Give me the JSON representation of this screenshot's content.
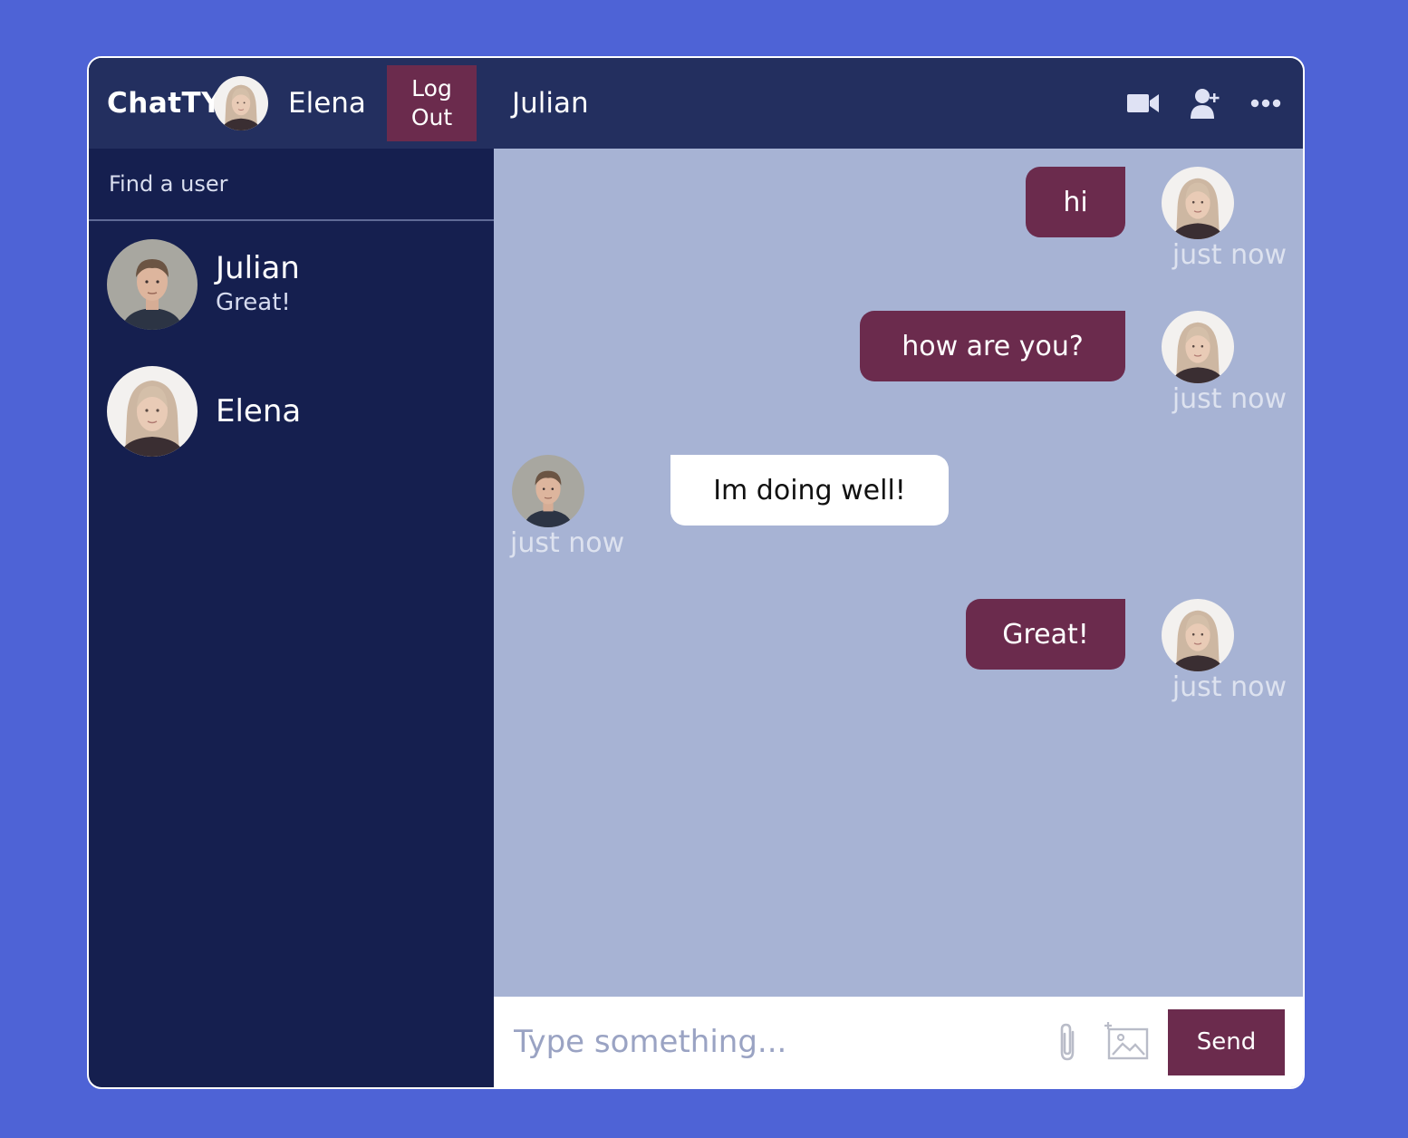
{
  "app": {
    "logo": "ChatTY"
  },
  "navbar": {
    "current_user": "Elena",
    "logout_label": "Log Out"
  },
  "search": {
    "placeholder": "Find a user"
  },
  "contacts": [
    {
      "name": "Julian",
      "last_message": "Great!",
      "avatar": "julian-avatar"
    },
    {
      "name": "Elena",
      "last_message": "",
      "avatar": "elena-avatar"
    }
  ],
  "chat": {
    "title": "Julian",
    "icons": [
      "video-camera-icon",
      "add-user-icon",
      "more-options-icon"
    ]
  },
  "messages": [
    {
      "text": "hi",
      "time": "just now",
      "owner": true
    },
    {
      "text": "how are you?",
      "time": "just now",
      "owner": true
    },
    {
      "text": "Im doing well!",
      "time": "just now",
      "owner": false
    },
    {
      "text": "Great!",
      "time": "just now",
      "owner": true
    }
  ],
  "input": {
    "placeholder": "Type something...",
    "send_label": "Send",
    "icons": [
      "paperclip-icon",
      "add-image-icon"
    ]
  },
  "colors": {
    "background": "#4e63d6",
    "sidebar": "#151f4f",
    "navbar": "#232f5f",
    "chat_background": "#a7b3d4",
    "accent": "#6b2b4d"
  }
}
